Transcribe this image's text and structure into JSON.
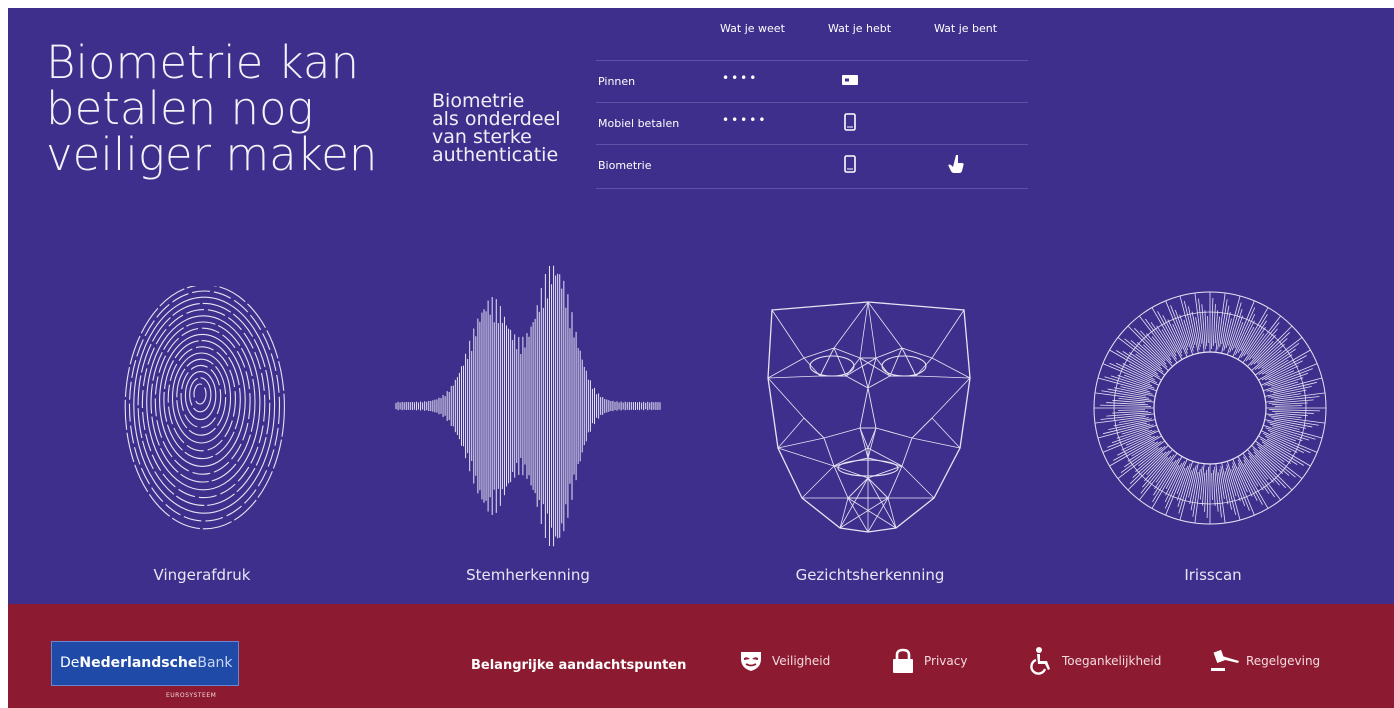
{
  "header": {
    "title_lines": [
      "Biometrie kan",
      "betalen nog",
      "veiliger maken"
    ],
    "subtitle_lines": [
      "Biometrie",
      "als onderdeel",
      "van sterke",
      "authenticatie"
    ]
  },
  "auth_table": {
    "columns": [
      "Wat je weet",
      "Wat je hebt",
      "Wat je bent"
    ],
    "rows": [
      {
        "label": "Pinnen",
        "know": "••••",
        "have_icon": "card-icon",
        "are_icon": ""
      },
      {
        "label": "Mobiel betalen",
        "know": "•••••",
        "have_icon": "phone-icon",
        "are_icon": ""
      },
      {
        "label": "Biometrie",
        "know": "",
        "have_icon": "phone-icon",
        "are_icon": "finger-icon"
      }
    ]
  },
  "biometrics": [
    {
      "label": "Vingerafdruk",
      "icon": "fingerprint-icon"
    },
    {
      "label": "Stemherkenning",
      "icon": "soundwave-icon"
    },
    {
      "label": "Gezichtsherkenning",
      "icon": "face-mesh-icon"
    },
    {
      "label": "Irisscan",
      "icon": "iris-icon"
    }
  ],
  "footer": {
    "logo": {
      "part1": "De",
      "part2": "Nederlandsche",
      "part3": "Bank",
      "sub": "EUROSYSTEEM"
    },
    "attention_label": "Belangrijke aandachtspunten",
    "items": [
      {
        "label": "Veiligheid",
        "icon": "shield-mask-icon"
      },
      {
        "label": "Privacy",
        "icon": "lock-icon"
      },
      {
        "label": "Toegankelijkheid",
        "icon": "wheelchair-icon"
      },
      {
        "label": "Regelgeving",
        "icon": "gavel-icon"
      }
    ]
  },
  "colors": {
    "panel": "#3f2f8c",
    "footer": "#8c1a30",
    "logo": "#1f4aa8"
  }
}
